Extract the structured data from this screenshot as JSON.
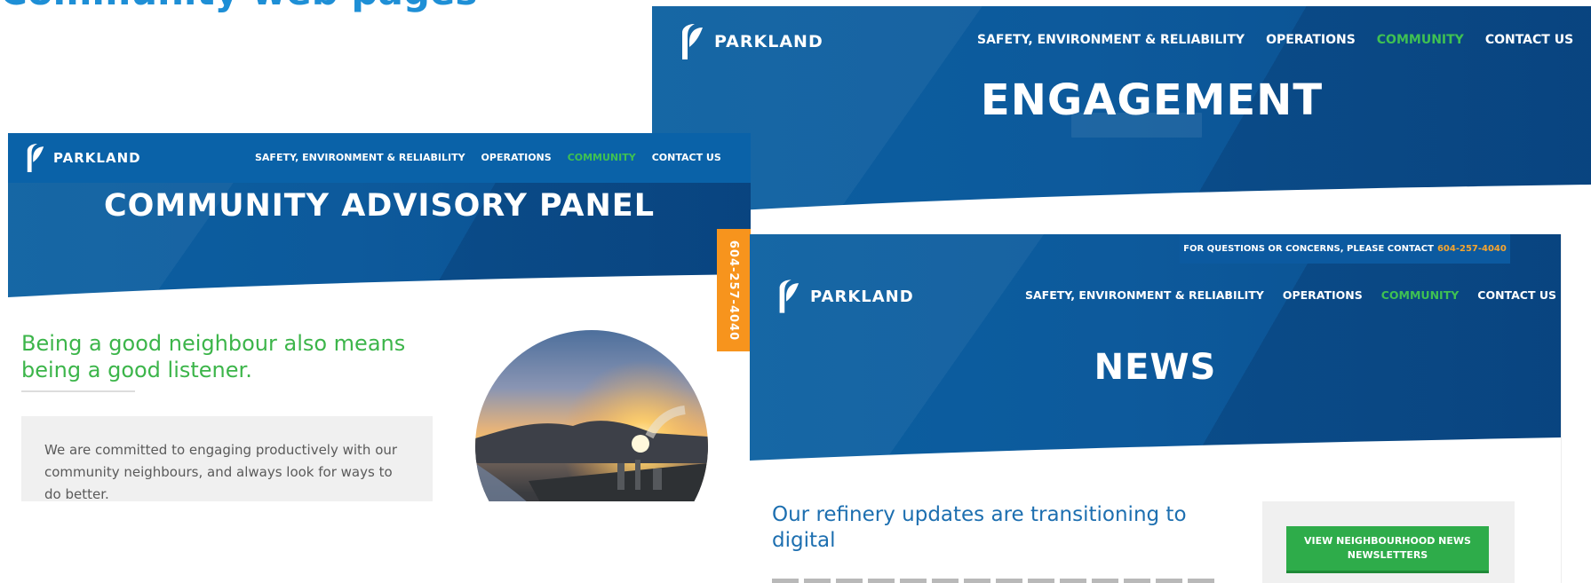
{
  "heading": {
    "text": "Community web pages"
  },
  "brand": {
    "name": "PARKLAND",
    "primary_color": "#0a5fa0",
    "accent_green": "#3fc152",
    "accent_orange": "#f7941d"
  },
  "nav": {
    "items": [
      {
        "label": "SAFETY, ENVIRONMENT & RELIABILITY"
      },
      {
        "label": "OPERATIONS"
      },
      {
        "label": "COMMUNITY",
        "active": true
      },
      {
        "label": "CONTACT US"
      }
    ]
  },
  "engagement": {
    "title": "ENGAGEMENT"
  },
  "cap": {
    "title": "COMMUNITY ADVISORY PANEL",
    "side_phone": "604-257-4040",
    "intro": "Being a good neighbour also means being a good listener.",
    "callout": "We are committed to engaging productively with our community neighbours, and always look for ways to do better.",
    "photo_icon": "refinery-sunset-photo"
  },
  "news": {
    "contact_prefix": "FOR QUESTIONS OR CONCERNS, PLEASE CONTACT",
    "contact_phone": "604-257-4040",
    "title": "NEWS",
    "headline": "Our refinery updates are transitioning to digital",
    "button_line1": "VIEW NEIGHBOURHOOD NEWS",
    "button_line2": "NEWSLETTERS"
  }
}
